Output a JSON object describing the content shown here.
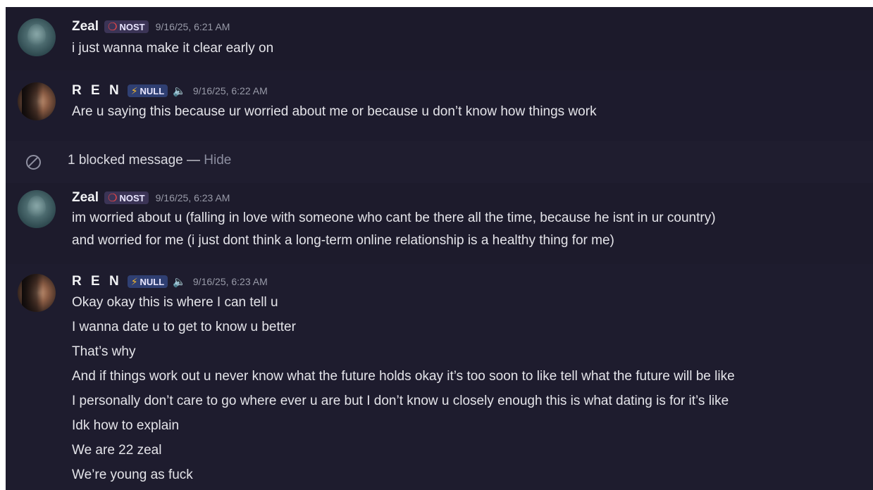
{
  "messages": [
    {
      "author": "Zeal",
      "tag": "NOST",
      "tag_icon": "red-ring-icon",
      "timestamp": "9/16/25, 6:21 AM",
      "lines": [
        "i just wanna make it clear early on"
      ]
    },
    {
      "author": "R E N",
      "tag": "NULL",
      "tag_icon": "lightning-bolt-icon",
      "timestamp": "9/16/25, 6:22 AM",
      "lines": [
        "Are u saying this because ur worried about me or because u don’t know how things work"
      ]
    },
    {
      "author": "Zeal",
      "tag": "NOST",
      "tag_icon": "red-ring-icon",
      "timestamp": "9/16/25, 6:23 AM",
      "lines": [
        "im worried about u (falling in love with someone who cant be there all the time, because he isnt in ur country)",
        "and worried for me (i just dont think a long-term online relationship is a healthy thing for me)"
      ]
    },
    {
      "author": "R E N",
      "tag": "NULL",
      "tag_icon": "lightning-bolt-icon",
      "timestamp": "9/16/25, 6:23 AM",
      "lines": [
        "Okay okay this is where I can tell u",
        "I wanna date u to get to know u better",
        "That’s why",
        "And if things work out u never know what the future holds okay it’s too soon to like tell what the future will be like",
        "I personally don’t care to go where ever u are but I don’t know u closely enough this is what dating is for it’s like",
        "Idk how to explain",
        "We are 22 zeal",
        "We’re young as fuck"
      ]
    }
  ],
  "blocked": {
    "text": "1 blocked message —",
    "action": "Hide"
  },
  "colors": {
    "background": "#1c1a2b",
    "nost_icon": "#f04747",
    "null_icon": "#f5b82e",
    "timestamp": "#989aa8"
  }
}
